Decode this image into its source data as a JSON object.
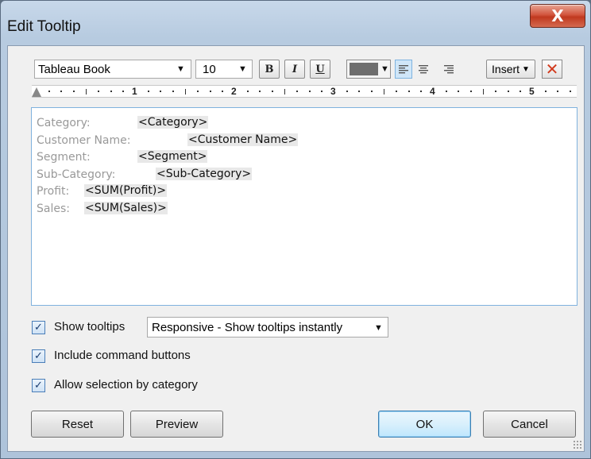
{
  "window": {
    "title": "Edit Tooltip",
    "close_glyph": "X"
  },
  "toolbar": {
    "font_family": "Tableau Book",
    "font_size": "10",
    "bold": "B",
    "italic": "I",
    "underline": "U",
    "text_color": "#6e6e6e",
    "insert_label": "Insert",
    "delete_glyph": "✕"
  },
  "ruler": {
    "numbers": [
      "1",
      "2",
      "3",
      "4",
      "5"
    ]
  },
  "editor": {
    "lines": [
      {
        "label": "Category:",
        "field": "<Category>"
      },
      {
        "label": "Customer Name:",
        "field": "<Customer Name>"
      },
      {
        "label": "Segment:",
        "field": "<Segment>"
      },
      {
        "label": "Sub-Category:",
        "field": "<Sub-Category>"
      },
      {
        "label": "Profit:",
        "field": "<SUM(Profit)>"
      },
      {
        "label": "Sales:",
        "field": "<SUM(Sales)>"
      }
    ]
  },
  "options": {
    "show_tooltips": {
      "label": "Show tooltips",
      "checked": true
    },
    "tooltip_mode": "Responsive - Show tooltips instantly",
    "include_command_buttons": {
      "label": "Include command buttons",
      "checked": true
    },
    "allow_selection_by_category": {
      "label": "Allow selection by category",
      "checked": true
    }
  },
  "buttons": {
    "reset": "Reset",
    "preview": "Preview",
    "ok": "OK",
    "cancel": "Cancel"
  },
  "colors": {
    "accent": "#3c7fb1",
    "close": "#c0391f"
  }
}
